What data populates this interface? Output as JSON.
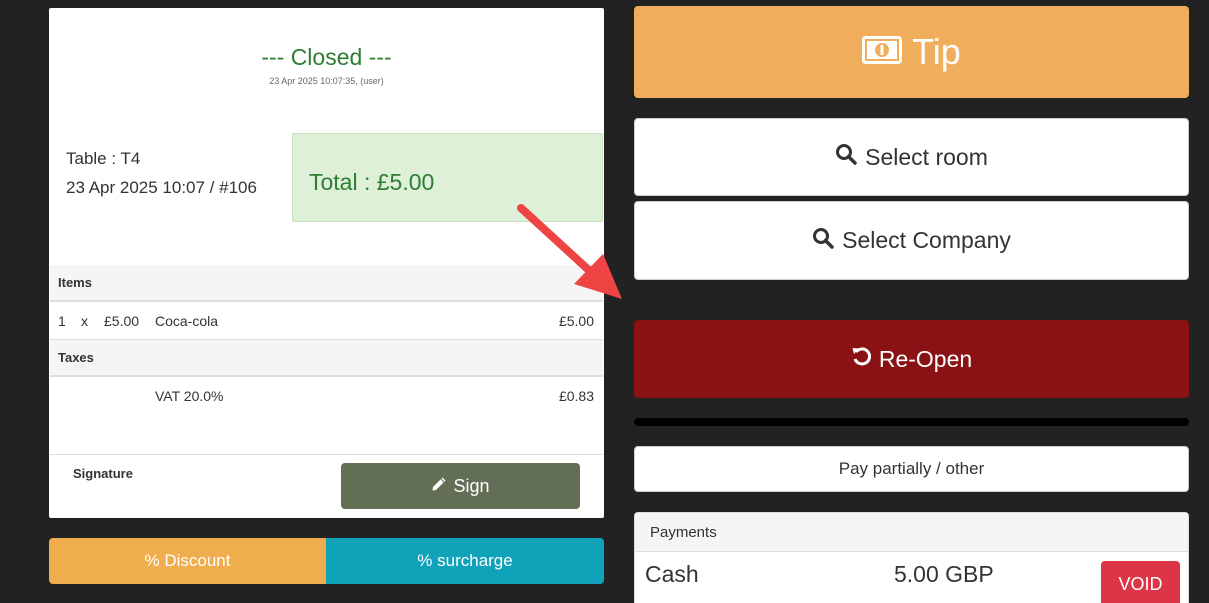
{
  "receipt": {
    "status_title": "--- Closed ---",
    "status_sub": "23 Apr 2025 10:07:35, (user)",
    "table_label": "Table : T4",
    "date_label": "23 Apr 2025 10:07 / #106",
    "total_label": "Total : £5.00",
    "items_header": "Items",
    "items": [
      {
        "qty": "1",
        "x": "x",
        "unit_price": "£5.00",
        "name": "Coca-cola",
        "amount": "£5.00"
      }
    ],
    "taxes_header": "Taxes",
    "taxes": [
      {
        "name": "VAT 20.0%",
        "amount": "£0.83"
      }
    ],
    "signature_label": "Signature",
    "sign_button": "Sign"
  },
  "adjust": {
    "discount_label": "% Discount",
    "surcharge_label": "% surcharge"
  },
  "actions": {
    "tip_label": "Tip",
    "select_room_label": "Select room",
    "select_company_label": "Select Company",
    "reopen_label": "Re-Open",
    "pay_partially_label": "Pay partially / other"
  },
  "payments": {
    "header": "Payments",
    "rows": [
      {
        "method": "Cash",
        "amount": "5.00 GBP",
        "void_label": "VOID"
      }
    ]
  },
  "colors": {
    "tip": "#f0ad5c",
    "reopen": "#8b1214",
    "sign": "#626e55",
    "discount": "#f0ad4e",
    "surcharge": "#10a2b8",
    "void": "#dc3545",
    "annotation_arrow": "#ef4444"
  },
  "icons": {
    "tip": "money-icon",
    "select_room": "search-icon",
    "select_company": "search-icon",
    "reopen": "undo-icon",
    "sign": "pencil-icon"
  }
}
